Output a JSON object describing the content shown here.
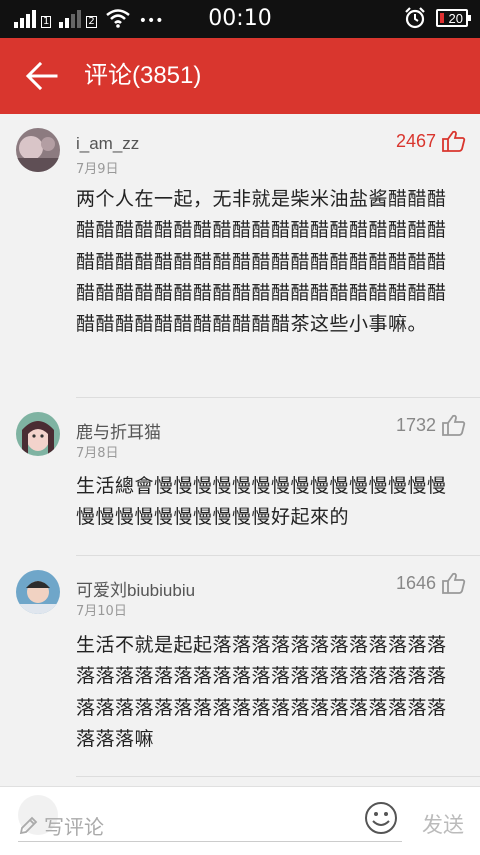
{
  "statusbar": {
    "sim1": "1",
    "sim2": "2",
    "dots": "•••",
    "time": "00:10",
    "battery": "20"
  },
  "header": {
    "title": "评论(3851)"
  },
  "comments": [
    {
      "username": "i_am_zz",
      "date": "7月9日",
      "likes": "2467",
      "text": "两个人在一起，无非就是柴米油盐酱醋醋醋醋醋醋醋醋醋醋醋醋醋醋醋醋醋醋醋醋醋醋醋醋醋醋醋醋醋醋醋醋醋醋醋醋醋醋醋醋醋醋醋醋醋醋醋醋醋醋醋醋醋醋醋醋醋醋醋醋醋醋醋醋醋醋醋醋醋醋醋茶这些小事嘛。"
    },
    {
      "username": "鹿与折耳猫",
      "date": "7月8日",
      "likes": "1732",
      "text": "生活總會慢慢慢慢慢慢慢慢慢慢慢慢慢慢慢慢慢慢慢慢慢慢慢慢慢好起來的"
    },
    {
      "username": "可爱刘biubiubiu",
      "date": "7月10日",
      "likes": "1646",
      "text": "生活不就是起起落落落落落落落落落落落落落落落落落落落落落落落落落落落落落落落落落落落落落落落落落落落落落落落落落落落落落嘛"
    }
  ],
  "bottombar": {
    "placeholder": "写评论",
    "send": "发送"
  },
  "colors": {
    "accent": "#d9362e",
    "statusbar": "#111111"
  }
}
